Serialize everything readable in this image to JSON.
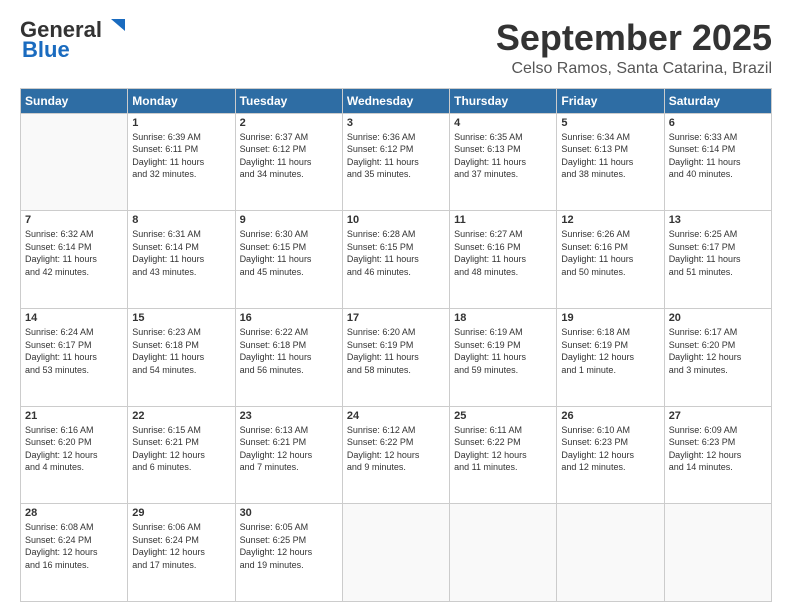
{
  "header": {
    "logo_general": "General",
    "logo_blue": "Blue",
    "month_title": "September 2025",
    "location": "Celso Ramos, Santa Catarina, Brazil"
  },
  "days_of_week": [
    "Sunday",
    "Monday",
    "Tuesday",
    "Wednesday",
    "Thursday",
    "Friday",
    "Saturday"
  ],
  "weeks": [
    [
      {
        "day": "",
        "info": ""
      },
      {
        "day": "1",
        "info": "Sunrise: 6:39 AM\nSunset: 6:11 PM\nDaylight: 11 hours\nand 32 minutes."
      },
      {
        "day": "2",
        "info": "Sunrise: 6:37 AM\nSunset: 6:12 PM\nDaylight: 11 hours\nand 34 minutes."
      },
      {
        "day": "3",
        "info": "Sunrise: 6:36 AM\nSunset: 6:12 PM\nDaylight: 11 hours\nand 35 minutes."
      },
      {
        "day": "4",
        "info": "Sunrise: 6:35 AM\nSunset: 6:13 PM\nDaylight: 11 hours\nand 37 minutes."
      },
      {
        "day": "5",
        "info": "Sunrise: 6:34 AM\nSunset: 6:13 PM\nDaylight: 11 hours\nand 38 minutes."
      },
      {
        "day": "6",
        "info": "Sunrise: 6:33 AM\nSunset: 6:14 PM\nDaylight: 11 hours\nand 40 minutes."
      }
    ],
    [
      {
        "day": "7",
        "info": "Sunrise: 6:32 AM\nSunset: 6:14 PM\nDaylight: 11 hours\nand 42 minutes."
      },
      {
        "day": "8",
        "info": "Sunrise: 6:31 AM\nSunset: 6:14 PM\nDaylight: 11 hours\nand 43 minutes."
      },
      {
        "day": "9",
        "info": "Sunrise: 6:30 AM\nSunset: 6:15 PM\nDaylight: 11 hours\nand 45 minutes."
      },
      {
        "day": "10",
        "info": "Sunrise: 6:28 AM\nSunset: 6:15 PM\nDaylight: 11 hours\nand 46 minutes."
      },
      {
        "day": "11",
        "info": "Sunrise: 6:27 AM\nSunset: 6:16 PM\nDaylight: 11 hours\nand 48 minutes."
      },
      {
        "day": "12",
        "info": "Sunrise: 6:26 AM\nSunset: 6:16 PM\nDaylight: 11 hours\nand 50 minutes."
      },
      {
        "day": "13",
        "info": "Sunrise: 6:25 AM\nSunset: 6:17 PM\nDaylight: 11 hours\nand 51 minutes."
      }
    ],
    [
      {
        "day": "14",
        "info": "Sunrise: 6:24 AM\nSunset: 6:17 PM\nDaylight: 11 hours\nand 53 minutes."
      },
      {
        "day": "15",
        "info": "Sunrise: 6:23 AM\nSunset: 6:18 PM\nDaylight: 11 hours\nand 54 minutes."
      },
      {
        "day": "16",
        "info": "Sunrise: 6:22 AM\nSunset: 6:18 PM\nDaylight: 11 hours\nand 56 minutes."
      },
      {
        "day": "17",
        "info": "Sunrise: 6:20 AM\nSunset: 6:19 PM\nDaylight: 11 hours\nand 58 minutes."
      },
      {
        "day": "18",
        "info": "Sunrise: 6:19 AM\nSunset: 6:19 PM\nDaylight: 11 hours\nand 59 minutes."
      },
      {
        "day": "19",
        "info": "Sunrise: 6:18 AM\nSunset: 6:19 PM\nDaylight: 12 hours\nand 1 minute."
      },
      {
        "day": "20",
        "info": "Sunrise: 6:17 AM\nSunset: 6:20 PM\nDaylight: 12 hours\nand 3 minutes."
      }
    ],
    [
      {
        "day": "21",
        "info": "Sunrise: 6:16 AM\nSunset: 6:20 PM\nDaylight: 12 hours\nand 4 minutes."
      },
      {
        "day": "22",
        "info": "Sunrise: 6:15 AM\nSunset: 6:21 PM\nDaylight: 12 hours\nand 6 minutes."
      },
      {
        "day": "23",
        "info": "Sunrise: 6:13 AM\nSunset: 6:21 PM\nDaylight: 12 hours\nand 7 minutes."
      },
      {
        "day": "24",
        "info": "Sunrise: 6:12 AM\nSunset: 6:22 PM\nDaylight: 12 hours\nand 9 minutes."
      },
      {
        "day": "25",
        "info": "Sunrise: 6:11 AM\nSunset: 6:22 PM\nDaylight: 12 hours\nand 11 minutes."
      },
      {
        "day": "26",
        "info": "Sunrise: 6:10 AM\nSunset: 6:23 PM\nDaylight: 12 hours\nand 12 minutes."
      },
      {
        "day": "27",
        "info": "Sunrise: 6:09 AM\nSunset: 6:23 PM\nDaylight: 12 hours\nand 14 minutes."
      }
    ],
    [
      {
        "day": "28",
        "info": "Sunrise: 6:08 AM\nSunset: 6:24 PM\nDaylight: 12 hours\nand 16 minutes."
      },
      {
        "day": "29",
        "info": "Sunrise: 6:06 AM\nSunset: 6:24 PM\nDaylight: 12 hours\nand 17 minutes."
      },
      {
        "day": "30",
        "info": "Sunrise: 6:05 AM\nSunset: 6:25 PM\nDaylight: 12 hours\nand 19 minutes."
      },
      {
        "day": "",
        "info": ""
      },
      {
        "day": "",
        "info": ""
      },
      {
        "day": "",
        "info": ""
      },
      {
        "day": "",
        "info": ""
      }
    ]
  ]
}
